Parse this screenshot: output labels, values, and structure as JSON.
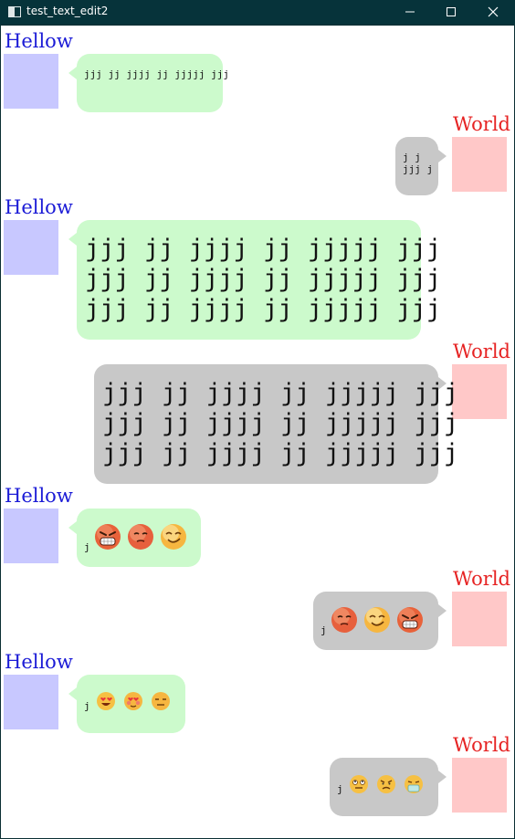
{
  "window": {
    "title": "test_text_edit2"
  },
  "names": {
    "left": "Hellow",
    "right": "World"
  },
  "messages": [
    {
      "side": "left",
      "text": "jjj jj jjjj jj jjjjj jjj"
    },
    {
      "side": "right",
      "lines": [
        "j j",
        "jjj j"
      ]
    },
    {
      "side": "left",
      "lines": [
        "jjj jj jjjj jj jjjjj jjj",
        "jjj jj jjjj jj jjjjj jjj",
        "jjj jj jjjj jj jjjjj jjj"
      ]
    },
    {
      "side": "right",
      "lines": [
        "jjj jj jjjj jj jjjjj jjj",
        "jjj jj jjjj jj jjjjj jjj",
        "jjj jj jjjj jj jjjjj jjj"
      ]
    },
    {
      "side": "left",
      "text": "j",
      "emojis": [
        "angry-grin-emoji",
        "red-face-emoji",
        "smirk-emoji"
      ]
    },
    {
      "side": "right",
      "text": "j",
      "emojis": [
        "red-face-emoji",
        "smirk-emoji",
        "angry-grin-emoji"
      ]
    },
    {
      "side": "left",
      "text": "j",
      "emojis": [
        "heart-eyes-emoji",
        "blush-emoji",
        "unamused-emoji"
      ]
    },
    {
      "side": "right",
      "text": "j",
      "emojis": [
        "rolling-eyes-emoji",
        "frown-emoji",
        "mask-emoji"
      ]
    }
  ],
  "colors": {
    "left_name": "#1b1bd6",
    "right_name": "#e62323",
    "left_avatar": "#c8c8ff",
    "right_avatar": "#ffc8c8",
    "left_bubble": "#ccfacc",
    "right_bubble": "#c8c8c8",
    "titlebar": "#06333a"
  }
}
